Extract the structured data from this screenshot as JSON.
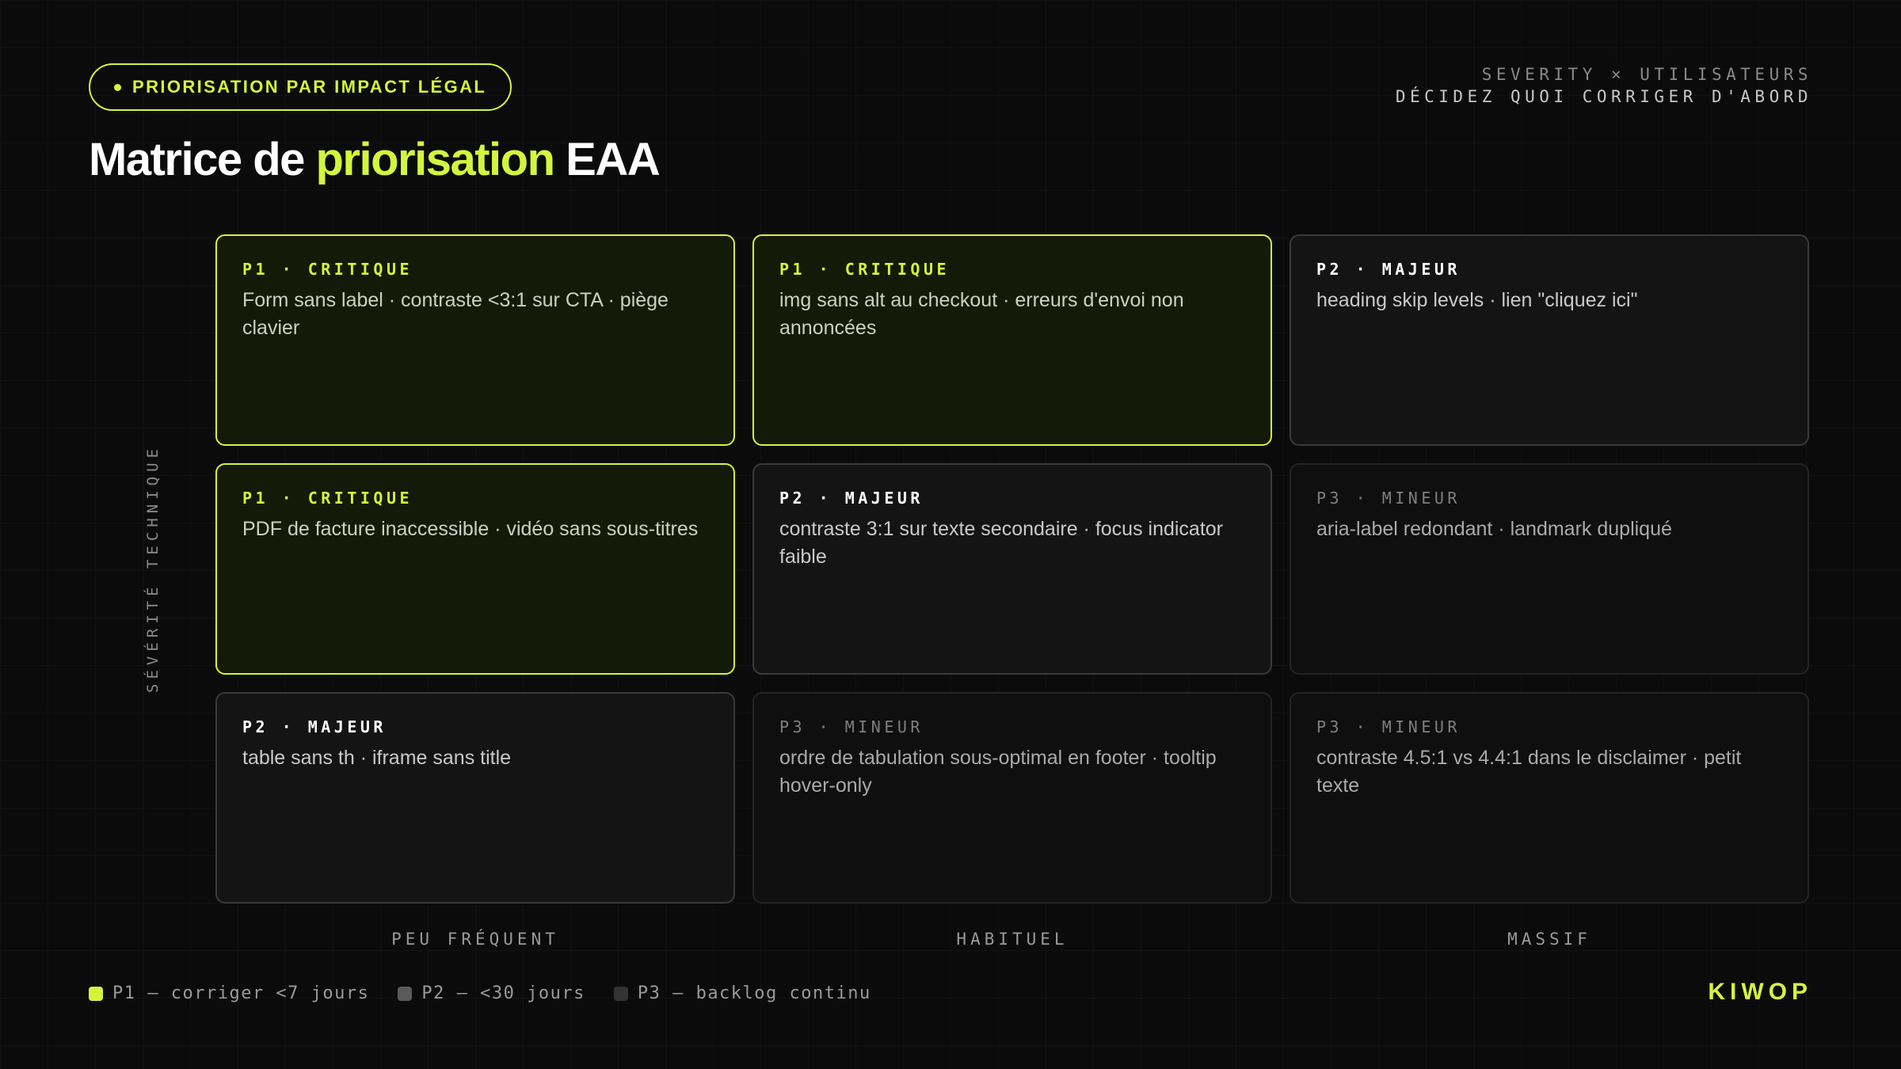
{
  "header": {
    "badge": "PRIORISATION PAR IMPACT LÉGAL",
    "title_before": "Matrice de ",
    "title_accent": "priorisation",
    "title_after": " EAA",
    "subtitle_line1": "SEVERITY × UTILISATEURS",
    "subtitle_line2": "DÉCIDEZ QUOI CORRIGER D'ABORD"
  },
  "axes": {
    "y_label": "SÉVÉRITÉ TECHNIQUE",
    "x_labels": [
      "PEU FRÉQUENT",
      "HABITUEL",
      "MASSIF"
    ]
  },
  "matrix": [
    [
      {
        "level": "p1",
        "label": "P1 · CRITIQUE",
        "desc": "Form sans label · contraste <3:1 sur CTA · piège clavier"
      },
      {
        "level": "p1",
        "label": "P1 · CRITIQUE",
        "desc": "img sans alt au checkout · erreurs d'envoi non annoncées"
      },
      {
        "level": "p2",
        "label": "P2 · MAJEUR",
        "desc": "heading skip levels · lien \"cliquez ici\""
      }
    ],
    [
      {
        "level": "p1",
        "label": "P1 · CRITIQUE",
        "desc": "PDF de facture inaccessible · vidéo sans sous-titres"
      },
      {
        "level": "p2",
        "label": "P2 · MAJEUR",
        "desc": "contraste 3:1 sur texte secondaire · focus indicator faible"
      },
      {
        "level": "p3",
        "label": "P3 · MINEUR",
        "desc": "aria-label redondant · landmark dupliqué"
      }
    ],
    [
      {
        "level": "p2",
        "label": "P2 · MAJEUR",
        "desc": "table sans th · iframe sans title"
      },
      {
        "level": "p3",
        "label": "P3 · MINEUR",
        "desc": "ordre de tabulation sous-optimal en footer · tooltip hover-only"
      },
      {
        "level": "p3",
        "label": "P3 · MINEUR",
        "desc": "contraste 4.5:1 vs 4.4:1 dans le disclaimer · petit texte"
      }
    ]
  ],
  "legend": [
    {
      "text": "P1 — corriger <7 jours",
      "color": "#d4f53c"
    },
    {
      "text": "P2 — <30 jours",
      "color": "#5a5a5a"
    },
    {
      "text": "P3 — backlog continu",
      "color": "#333333"
    }
  ],
  "brand": "KIWOP"
}
